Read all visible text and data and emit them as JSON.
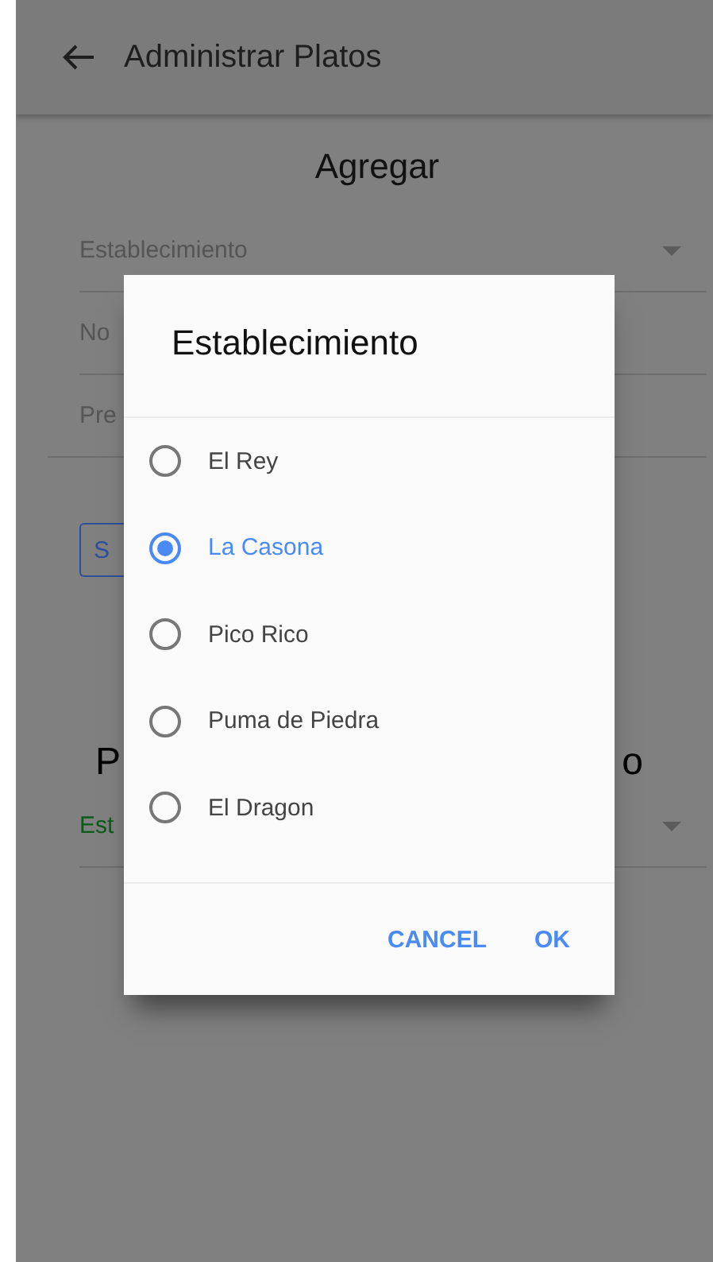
{
  "app_bar": {
    "title": "Administrar Platos"
  },
  "form": {
    "heading": "Agregar",
    "fields": [
      {
        "kind": "dropdown",
        "label": "Establecimiento"
      },
      {
        "kind": "text",
        "label": "No"
      },
      {
        "kind": "text",
        "label": "Pre"
      }
    ],
    "button": "S"
  },
  "section": {
    "heading_parts": [
      "P",
      "o"
    ],
    "field": {
      "kind": "dropdown",
      "label": "Est",
      "focused": true
    }
  },
  "dialog": {
    "title": "Establecimiento",
    "options": [
      {
        "label": "El Rey",
        "selected": false
      },
      {
        "label": "La Casona",
        "selected": true
      },
      {
        "label": "Pico Rico",
        "selected": false
      },
      {
        "label": "Puma de Piedra",
        "selected": false
      },
      {
        "label": "El Dragon",
        "selected": false
      }
    ],
    "actions": [
      "CANCEL",
      "OK"
    ]
  }
}
